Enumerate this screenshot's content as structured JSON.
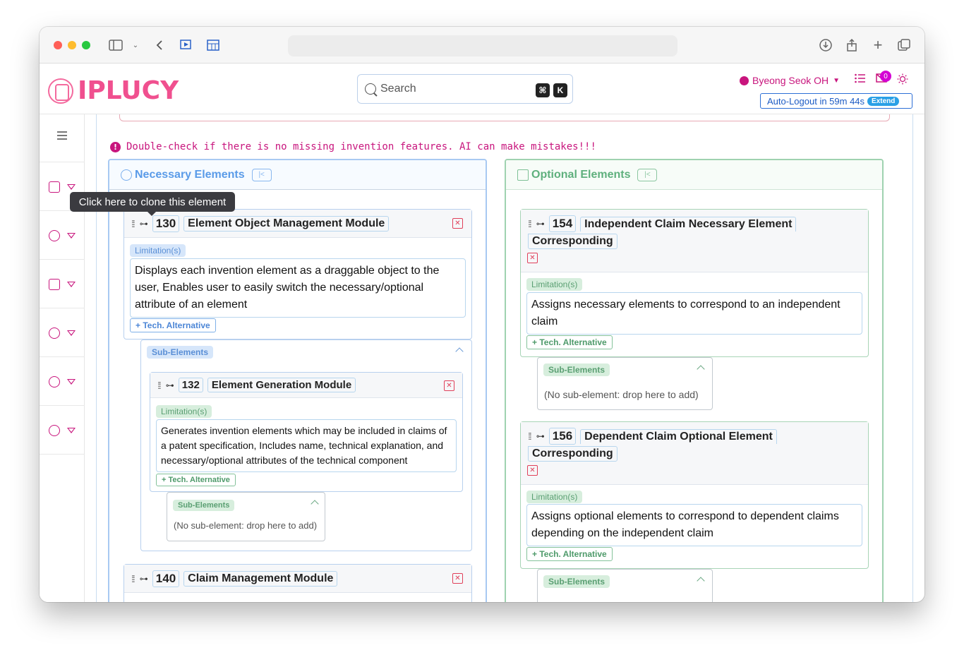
{
  "app": {
    "logo_text": "IPLUCY"
  },
  "search": {
    "placeholder": "Search",
    "kbd_cmd": "⌘",
    "kbd_key": "K"
  },
  "user": {
    "name": "Byeong Seok OH",
    "notifications": "0",
    "autologout": "Auto-Logout in 59m 44s",
    "extend_label": "Extend"
  },
  "warning": "Double-check if there is no missing invention features. AI can make mistakes!!!",
  "tooltip": "Click here to clone this element",
  "necessary": {
    "title": "Necessary Elements",
    "elements": [
      {
        "num": "130",
        "name": "Element Object Management Module",
        "limitation_label": "Limitation(s)",
        "limitation": "Displays each invention element as a draggable object to the user, Enables user to easily switch the necessary/optional attribute of an element",
        "tech_alt": "+ Tech. Alternative",
        "sub_label": "Sub-Elements"
      },
      {
        "num": "132",
        "name": "Element Generation Module",
        "limitation_label": "Limitation(s)",
        "limitation": "Generates invention elements which may be included in claims of a patent specification, Includes name, technical explanation, and necessary/optional attributes of the technical component",
        "tech_alt": "+ Tech. Alternative",
        "sub_label": "Sub-Elements",
        "no_sub": "(No sub-element: drop here to add)"
      },
      {
        "num": "140",
        "name": "Claim Management Module"
      }
    ]
  },
  "optional": {
    "title": "Optional Elements",
    "elements": [
      {
        "num": "154",
        "name_line1": "Independent Claim Necessary Element",
        "name_line2": "Corresponding",
        "limitation_label": "Limitation(s)",
        "limitation": "Assigns necessary elements to correspond to an independent claim",
        "tech_alt": "+ Tech. Alternative",
        "sub_label": "Sub-Elements",
        "no_sub": "(No sub-element: drop here to add)"
      },
      {
        "num": "156",
        "name_line1": "Dependent Claim Optional Element",
        "name_line2": "Corresponding",
        "limitation_label": "Limitation(s)",
        "limitation": "Assigns optional elements to correspond to dependent claims depending on the independent claim",
        "tech_alt": "+ Tech. Alternative",
        "sub_label": "Sub-Elements"
      }
    ]
  },
  "icons": {
    "grip": "grip-icon",
    "clone": "clone-icon",
    "delete": "close-icon"
  },
  "colors": {
    "brand": "#f0508f",
    "accent": "#c8157d",
    "necessary": "#5a9be8",
    "optional": "#5fb07d"
  }
}
